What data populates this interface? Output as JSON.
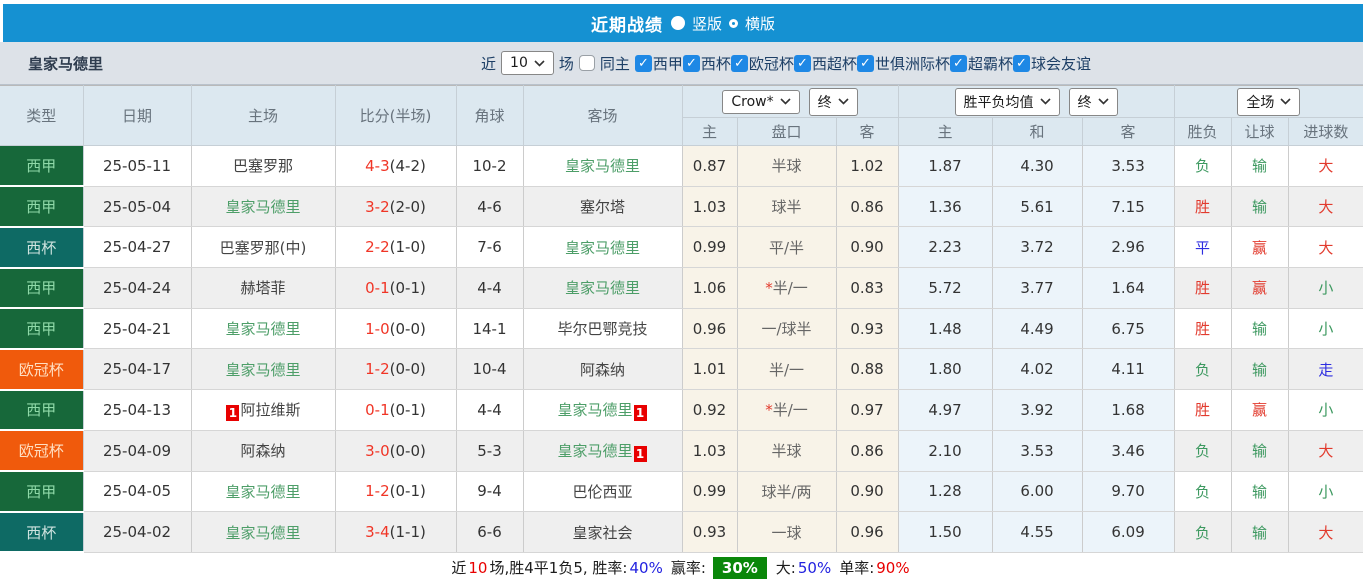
{
  "header": {
    "title": "近期战绩",
    "radio_vertical": "竖版",
    "radio_horizontal": "横版"
  },
  "filter": {
    "team": "皇家马德里",
    "near_label": "近",
    "count_value": "10",
    "games_label": "场",
    "same_home_label": "同主",
    "leagues": [
      "西甲",
      "西杯",
      "欧冠杯",
      "西超杯",
      "世俱洲际杯",
      "超霸杯",
      "球会友谊"
    ]
  },
  "table": {
    "columns": {
      "type": "类型",
      "date": "日期",
      "home": "主场",
      "score": "比分(半场)",
      "corner": "角球",
      "away": "客场"
    },
    "selects": {
      "crow": "Crow*",
      "crow_period": "终",
      "avg": "胜平负均值",
      "avg_period": "终",
      "scope": "全场"
    },
    "sub_headers": [
      "主",
      "盘口",
      "客",
      "主",
      "和",
      "客",
      "胜负",
      "让球",
      "进球数"
    ],
    "rows": [
      {
        "league": "西甲",
        "league_color": "green",
        "date": "25-05-11",
        "home": {
          "name": "巴塞罗那",
          "self": false,
          "red_card": ""
        },
        "score_ft": "4-3",
        "score_ht": "(4-2)",
        "corner": "10-2",
        "away": {
          "name": "皇家马德里",
          "self": true,
          "red_card": ""
        },
        "crow": {
          "home": "0.87",
          "star": false,
          "handicap": "半球",
          "away": "1.02"
        },
        "avg": {
          "home": "1.87",
          "draw": "4.30",
          "away": "3.53"
        },
        "result": {
          "text": "负",
          "color": "green"
        },
        "let_result": {
          "text": "输",
          "color": "green"
        },
        "goals": {
          "text": "大",
          "color": "red"
        }
      },
      {
        "league": "西甲",
        "league_color": "green",
        "date": "25-05-04",
        "home": {
          "name": "皇家马德里",
          "self": true,
          "red_card": ""
        },
        "score_ft": "3-2",
        "score_ht": "(2-0)",
        "corner": "4-6",
        "away": {
          "name": "塞尔塔",
          "self": false,
          "red_card": ""
        },
        "crow": {
          "home": "1.03",
          "star": false,
          "handicap": "球半",
          "away": "0.86"
        },
        "avg": {
          "home": "1.36",
          "draw": "5.61",
          "away": "7.15"
        },
        "result": {
          "text": "胜",
          "color": "red"
        },
        "let_result": {
          "text": "输",
          "color": "green"
        },
        "goals": {
          "text": "大",
          "color": "red"
        }
      },
      {
        "league": "西杯",
        "league_color": "teal",
        "date": "25-04-27",
        "home": {
          "name": "巴塞罗那(中)",
          "self": false,
          "red_card": ""
        },
        "score_ft": "2-2",
        "score_ht": "(1-0)",
        "corner": "7-6",
        "away": {
          "name": "皇家马德里",
          "self": true,
          "red_card": ""
        },
        "crow": {
          "home": "0.99",
          "star": false,
          "handicap": "平/半",
          "away": "0.90"
        },
        "avg": {
          "home": "2.23",
          "draw": "3.72",
          "away": "2.96"
        },
        "result": {
          "text": "平",
          "color": "blue"
        },
        "let_result": {
          "text": "赢",
          "color": "red"
        },
        "goals": {
          "text": "大",
          "color": "red"
        }
      },
      {
        "league": "西甲",
        "league_color": "green",
        "date": "25-04-24",
        "home": {
          "name": "赫塔菲",
          "self": false,
          "red_card": ""
        },
        "score_ft": "0-1",
        "score_ht": "(0-1)",
        "corner": "4-4",
        "away": {
          "name": "皇家马德里",
          "self": true,
          "red_card": ""
        },
        "crow": {
          "home": "1.06",
          "star": true,
          "handicap": "半/一",
          "away": "0.83"
        },
        "avg": {
          "home": "5.72",
          "draw": "3.77",
          "away": "1.64"
        },
        "result": {
          "text": "胜",
          "color": "red"
        },
        "let_result": {
          "text": "赢",
          "color": "red"
        },
        "goals": {
          "text": "小",
          "color": "green"
        }
      },
      {
        "league": "西甲",
        "league_color": "green",
        "date": "25-04-21",
        "home": {
          "name": "皇家马德里",
          "self": true,
          "red_card": ""
        },
        "score_ft": "1-0",
        "score_ht": "(0-0)",
        "corner": "14-1",
        "away": {
          "name": "毕尔巴鄂竞技",
          "self": false,
          "red_card": ""
        },
        "crow": {
          "home": "0.96",
          "star": false,
          "handicap": "一/球半",
          "away": "0.93"
        },
        "avg": {
          "home": "1.48",
          "draw": "4.49",
          "away": "6.75"
        },
        "result": {
          "text": "胜",
          "color": "red"
        },
        "let_result": {
          "text": "输",
          "color": "green"
        },
        "goals": {
          "text": "小",
          "color": "green"
        }
      },
      {
        "league": "欧冠杯",
        "league_color": "orange",
        "date": "25-04-17",
        "home": {
          "name": "皇家马德里",
          "self": true,
          "red_card": ""
        },
        "score_ft": "1-2",
        "score_ht": "(0-0)",
        "corner": "10-4",
        "away": {
          "name": "阿森纳",
          "self": false,
          "red_card": ""
        },
        "crow": {
          "home": "1.01",
          "star": false,
          "handicap": "半/一",
          "away": "0.88"
        },
        "avg": {
          "home": "1.80",
          "draw": "4.02",
          "away": "4.11"
        },
        "result": {
          "text": "负",
          "color": "green"
        },
        "let_result": {
          "text": "输",
          "color": "green"
        },
        "goals": {
          "text": "走",
          "color": "blue"
        }
      },
      {
        "league": "西甲",
        "league_color": "green",
        "date": "25-04-13",
        "home": {
          "name": "阿拉维斯",
          "self": false,
          "red_card": "1"
        },
        "score_ft": "0-1",
        "score_ht": "(0-1)",
        "corner": "4-4",
        "away": {
          "name": "皇家马德里",
          "self": true,
          "red_card": "1"
        },
        "crow": {
          "home": "0.92",
          "star": true,
          "handicap": "半/一",
          "away": "0.97"
        },
        "avg": {
          "home": "4.97",
          "draw": "3.92",
          "away": "1.68"
        },
        "result": {
          "text": "胜",
          "color": "red"
        },
        "let_result": {
          "text": "赢",
          "color": "red"
        },
        "goals": {
          "text": "小",
          "color": "green"
        }
      },
      {
        "league": "欧冠杯",
        "league_color": "orange",
        "date": "25-04-09",
        "home": {
          "name": "阿森纳",
          "self": false,
          "red_card": ""
        },
        "score_ft": "3-0",
        "score_ht": "(0-0)",
        "corner": "5-3",
        "away": {
          "name": "皇家马德里",
          "self": true,
          "red_card": "1"
        },
        "crow": {
          "home": "1.03",
          "star": false,
          "handicap": "半球",
          "away": "0.86"
        },
        "avg": {
          "home": "2.10",
          "draw": "3.53",
          "away": "3.46"
        },
        "result": {
          "text": "负",
          "color": "green"
        },
        "let_result": {
          "text": "输",
          "color": "green"
        },
        "goals": {
          "text": "大",
          "color": "red"
        }
      },
      {
        "league": "西甲",
        "league_color": "green",
        "date": "25-04-05",
        "home": {
          "name": "皇家马德里",
          "self": true,
          "red_card": ""
        },
        "score_ft": "1-2",
        "score_ht": "(0-1)",
        "corner": "9-4",
        "away": {
          "name": "巴伦西亚",
          "self": false,
          "red_card": ""
        },
        "crow": {
          "home": "0.99",
          "star": false,
          "handicap": "球半/两",
          "away": "0.90"
        },
        "avg": {
          "home": "1.28",
          "draw": "6.00",
          "away": "9.70"
        },
        "result": {
          "text": "负",
          "color": "green"
        },
        "let_result": {
          "text": "输",
          "color": "green"
        },
        "goals": {
          "text": "小",
          "color": "green"
        }
      },
      {
        "league": "西杯",
        "league_color": "teal",
        "date": "25-04-02",
        "home": {
          "name": "皇家马德里",
          "self": true,
          "red_card": ""
        },
        "score_ft": "3-4",
        "score_ht": "(1-1)",
        "corner": "6-6",
        "away": {
          "name": "皇家社会",
          "self": false,
          "red_card": ""
        },
        "crow": {
          "home": "0.93",
          "star": false,
          "handicap": "一球",
          "away": "0.96"
        },
        "avg": {
          "home": "1.50",
          "draw": "4.55",
          "away": "6.09"
        },
        "result": {
          "text": "负",
          "color": "green"
        },
        "let_result": {
          "text": "输",
          "color": "green"
        },
        "goals": {
          "text": "大",
          "color": "red"
        }
      }
    ]
  },
  "footer": {
    "near_label": "近",
    "near_count": "10",
    "summary": "场,胜4平1负5, 胜率:",
    "win_rate": "40%",
    "profit_label": "赢率:",
    "profit_rate": "30%",
    "big_label": "大:",
    "big_rate": "50%",
    "single_label": "单率:",
    "single_rate": "90%"
  },
  "colors": {
    "accent_blue": "#1591d2",
    "score_red": "#f03526",
    "self_team_green": "#4d9e68",
    "league_green": "#17683a",
    "league_teal": "#0e6a64",
    "league_orange": "#f05a0c",
    "checkbox_blue": "#1e88e5",
    "value_blue": "#2222e0",
    "profit_bg_green": "#0a870a",
    "red_card_red": "#e80000"
  }
}
